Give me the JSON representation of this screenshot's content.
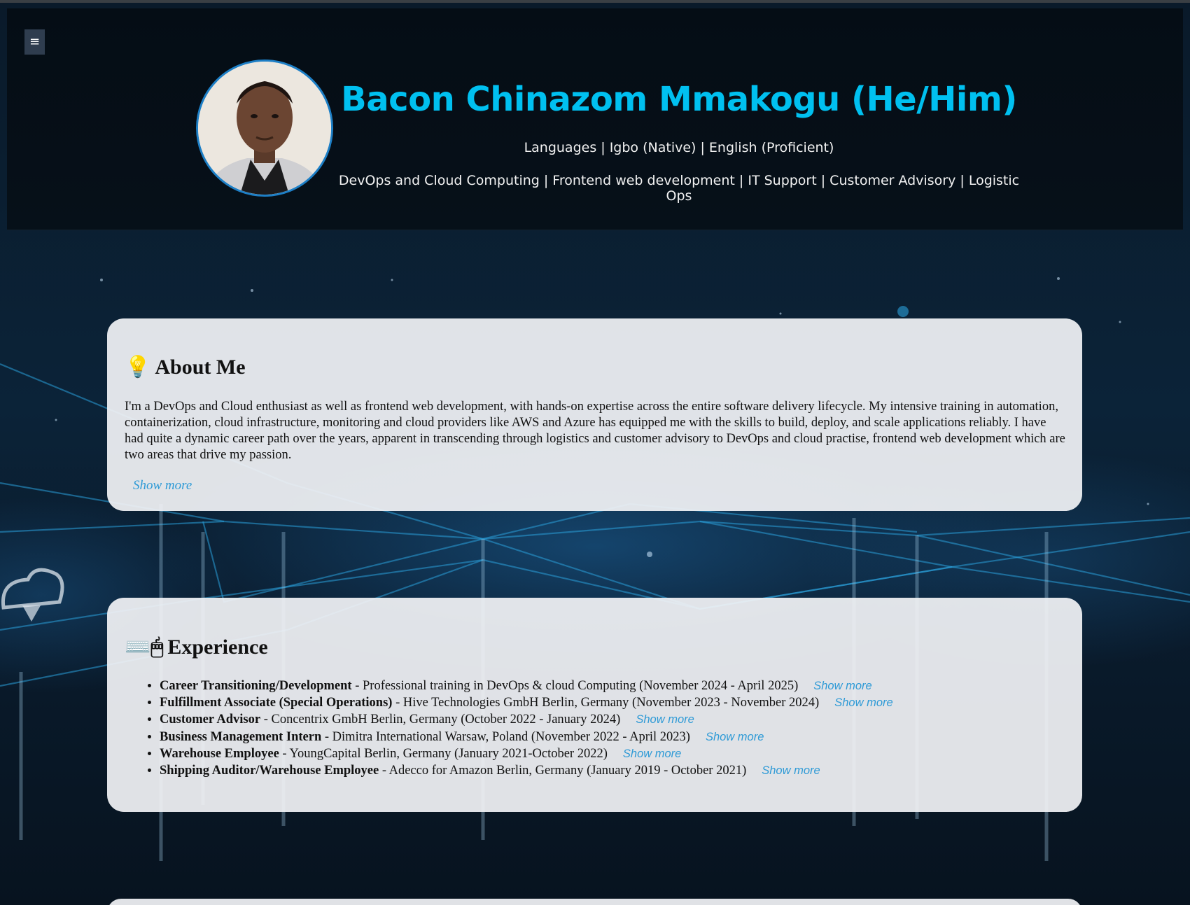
{
  "header": {
    "menu_icon": "≡",
    "name": "Bacon Chinazom Mmakogu (He/Him)",
    "languages": "Languages | Igbo (Native) | English (Proficient)",
    "skills": "DevOps and Cloud Computing | Frontend web development | IT Support | Customer Advisory | Logistic Ops"
  },
  "about": {
    "icon": "💡",
    "title": "About Me",
    "text": "I'm a DevOps and Cloud enthusiast as well as frontend web development, with hands-on expertise across the entire software delivery lifecycle. My intensive training in automation, containerization, cloud infrastructure, monitoring and cloud providers like AWS and Azure has equipped me with the skills to build, deploy, and scale applications reliably. I have had quite a dynamic career path over the years, apparent in transcending through logistics and customer advisory to DevOps and cloud practise, frontend web development which are two areas that drive my passion.",
    "show_more": "Show more"
  },
  "experience": {
    "icon": "⌨️🖱",
    "title": "Experience",
    "items": [
      {
        "role": "Career Transitioning/Development",
        "detail": " - Professional training in DevOps & cloud Computing (November 2024 - April 2025)",
        "show_more": "Show more"
      },
      {
        "role": "Fulfillment Associate (Special Operations)",
        "detail": " - Hive Technologies GmbH Berlin, Germany (November 2023 - November 2024)",
        "show_more": "Show more"
      },
      {
        "role": "Customer Advisor",
        "detail": " - Concentrix GmbH Berlin, Germany (October 2022 - January 2024)",
        "show_more": "Show more"
      },
      {
        "role": "Business Management Intern",
        "detail": " - Dimitra International Warsaw, Poland (November 2022 - April 2023)",
        "show_more": "Show more"
      },
      {
        "role": "Warehouse Employee",
        "detail": " - YoungCapital Berlin, Germany (January 2021-October 2022)",
        "show_more": "Show more"
      },
      {
        "role": "Shipping Auditor/Warehouse Employee",
        "detail": " - Adecco for Amazon Berlin, Germany (January 2019 - October 2021)",
        "show_more": "Show more"
      }
    ]
  },
  "colors": {
    "accent": "#00c0f0",
    "link": "#2e9ad6",
    "card": "#f1f2f5"
  }
}
